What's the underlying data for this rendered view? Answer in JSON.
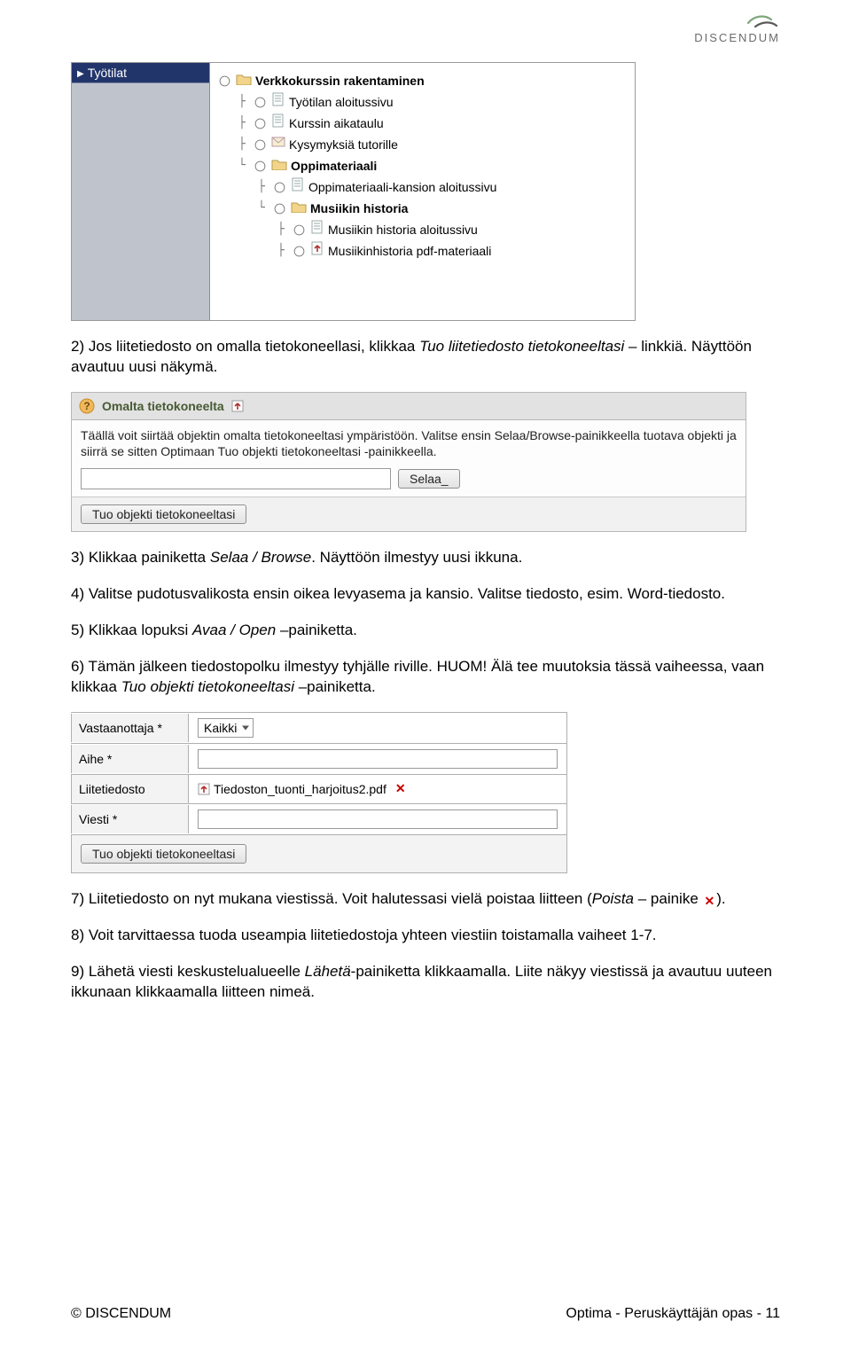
{
  "brand": "DISCENDUM",
  "screenshot1": {
    "sidebar_title": "Työtilat",
    "nodes": [
      {
        "indent": 0,
        "branch": "",
        "bold": true,
        "icon": "folder",
        "label": "Verkkokurssin rakentaminen"
      },
      {
        "indent": 1,
        "branch": "├",
        "bold": false,
        "icon": "page",
        "label": "Työtilan aloitussivu"
      },
      {
        "indent": 1,
        "branch": "├",
        "bold": false,
        "icon": "page",
        "label": "Kurssin aikataulu"
      },
      {
        "indent": 1,
        "branch": "├",
        "bold": false,
        "icon": "mail",
        "label": "Kysymyksiä tutorille"
      },
      {
        "indent": 1,
        "branch": "└",
        "bold": true,
        "icon": "folder",
        "label": "Oppimateriaali"
      },
      {
        "indent": 2,
        "branch": "├",
        "bold": false,
        "icon": "page",
        "label": "Oppimateriaali-kansion aloitussivu"
      },
      {
        "indent": 2,
        "branch": "└",
        "bold": true,
        "icon": "folder",
        "label": "Musiikin historia"
      },
      {
        "indent": 3,
        "branch": "├",
        "bold": false,
        "icon": "page",
        "label": "Musiikin historia aloitussivu"
      },
      {
        "indent": 3,
        "branch": "├",
        "bold": false,
        "icon": "pdf",
        "label": "Musiikinhistoria pdf-materiaali"
      }
    ]
  },
  "para_2_pre": "2) Jos liitetiedosto on omalla tietokoneellasi, klikkaa ",
  "para_2_em": "Tuo liitetiedosto tietokoneeltasi",
  "para_2_post": " – linkkiä. Näyttöön avautuu uusi näkymä.",
  "screenshot2": {
    "title": "Omalta tietokoneelta",
    "description": "Täällä voit siirtää objektin omalta tietokoneeltasi ympäristöön. Valitse ensin Selaa/Browse-painikkeella tuotava objekti ja siirrä se sitten Optimaan Tuo objekti tietokoneeltasi -painikkeella.",
    "file_value": "",
    "browse_label": "Selaa_",
    "submit_label": "Tuo objekti tietokoneeltasi"
  },
  "para_3_pre": "3) Klikkaa painiketta ",
  "para_3_em": "Selaa / Browse",
  "para_3_post": ". Näyttöön ilmestyy uusi ikkuna.",
  "para_4": "4) Valitse pudotusvalikosta ensin oikea levyasema ja kansio. Valitse tiedosto, esim. Word-tiedosto.",
  "para_5_pre": "5) Klikkaa lopuksi ",
  "para_5_em": "Avaa / Open",
  "para_5_post": " –painiketta.",
  "para_6_pre": "6) Tämän jälkeen tiedostopolku ilmestyy tyhjälle riville. HUOM! Älä tee muutoksia tässä vaiheessa, vaan klikkaa ",
  "para_6_em": "Tuo objekti tietokoneeltasi",
  "para_6_post": " –painiketta.",
  "screenshot3": {
    "labels": {
      "recipient": "Vastaanottaja *",
      "subject": "Aihe *",
      "attach": "Liitetiedosto",
      "message": "Viesti *"
    },
    "recipient_value": "Kaikki",
    "attachment_name": "Tiedoston_tuonti_harjoitus2.pdf",
    "footer_button": "Tuo objekti tietokoneeltasi"
  },
  "para_7_pre": "7) Liitetiedosto on nyt mukana viestissä. Voit halutessasi vielä poistaa liitteen (",
  "para_7_em": "Poista",
  "para_7_mid": " – painike ",
  "para_7_post": ").",
  "para_8": "8) Voit tarvittaessa tuoda useampia liitetiedostoja yhteen viestiin toistamalla vaiheet 1-7.",
  "para_9_pre": "9) Lähetä viesti keskustelualueelle ",
  "para_9_em": "Lähetä",
  "para_9_post": "-painiketta klikkaamalla. Liite näkyy viestissä ja avautuu uuteen ikkunaan klikkaamalla liitteen nimeä.",
  "footer_left": "© DISCENDUM",
  "footer_right": "Optima - Peruskäyttäjän opas - 11"
}
